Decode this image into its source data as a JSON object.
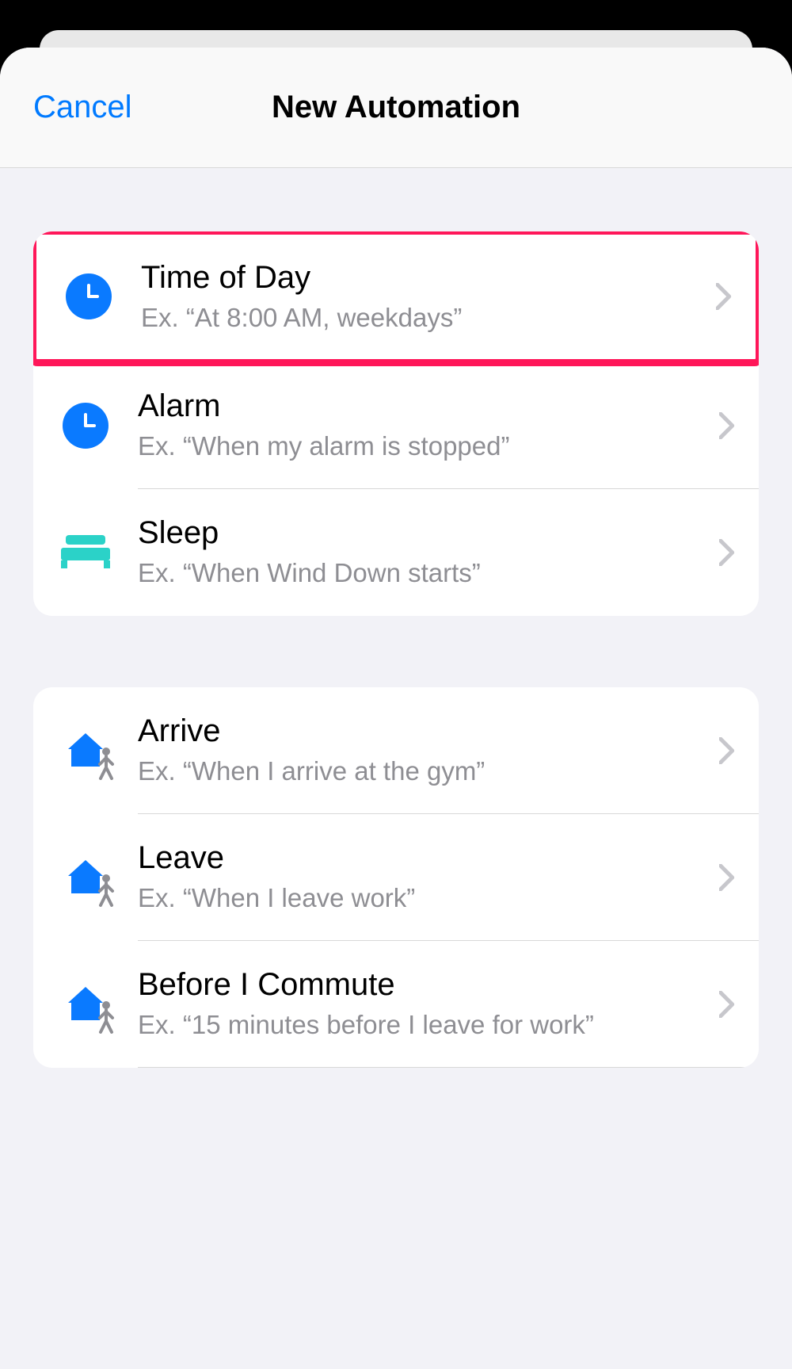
{
  "header": {
    "cancel_label": "Cancel",
    "title": "New Automation"
  },
  "groups": [
    {
      "items": [
        {
          "icon": "clock",
          "title": "Time of Day",
          "subtitle": "Ex. “At 8:00 AM, weekdays”",
          "highlighted": true
        },
        {
          "icon": "clock",
          "title": "Alarm",
          "subtitle": "Ex. “When my alarm is stopped”"
        },
        {
          "icon": "bed",
          "title": "Sleep",
          "subtitle": "Ex. “When Wind Down starts”"
        }
      ]
    },
    {
      "items": [
        {
          "icon": "home-arrive",
          "title": "Arrive",
          "subtitle": "Ex. “When I arrive at the gym”"
        },
        {
          "icon": "home-leave",
          "title": "Leave",
          "subtitle": "Ex. “When I leave work”"
        },
        {
          "icon": "home-commute",
          "title": "Before I Commute",
          "subtitle": "Ex. “15 minutes before I leave for work”"
        }
      ]
    }
  ]
}
